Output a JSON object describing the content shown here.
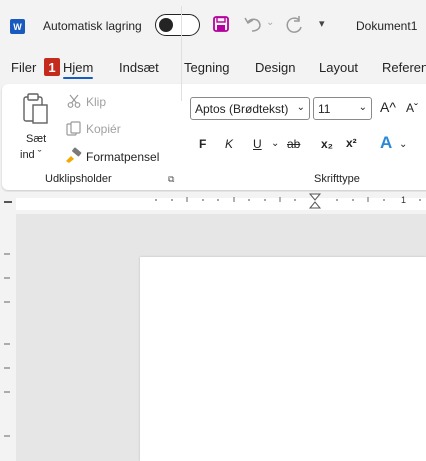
{
  "titlebar": {
    "app_icon": "word-logo-icon",
    "autosave_label": "Automatisk lagring",
    "autosave_state": "off",
    "doc_title": "Dokument1"
  },
  "tabs": [
    {
      "label": "Filer"
    },
    {
      "label": "Hjem",
      "active": true
    },
    {
      "label": "Indsæt"
    },
    {
      "label": "Tegning"
    },
    {
      "label": "Design"
    },
    {
      "label": "Layout"
    },
    {
      "label": "Referen"
    }
  ],
  "keytip": "1",
  "clipboard": {
    "paste_label_1": "Sæt",
    "paste_label_2": "ind ˇ",
    "cut_label": "Klip",
    "copy_label": "Kopiér",
    "format_painter_label": "Formatpensel",
    "group_label": "Udklipsholder"
  },
  "font": {
    "font_name": "Aptos (Brødtekst)",
    "font_size": "11",
    "bold": "F",
    "italic": "K",
    "underline": "U",
    "strikethrough": "ab",
    "subscript": "x₂",
    "superscript": "x²",
    "grow": "A^",
    "shrink": "Aˇ",
    "group_label": "Skrifttype"
  },
  "ruler": {
    "marker_number": "1"
  },
  "colors": {
    "accent": "#185abd",
    "keytip": "#c42b1c",
    "save_icon": "#b4009e",
    "text_effects": "#2b88d8"
  }
}
